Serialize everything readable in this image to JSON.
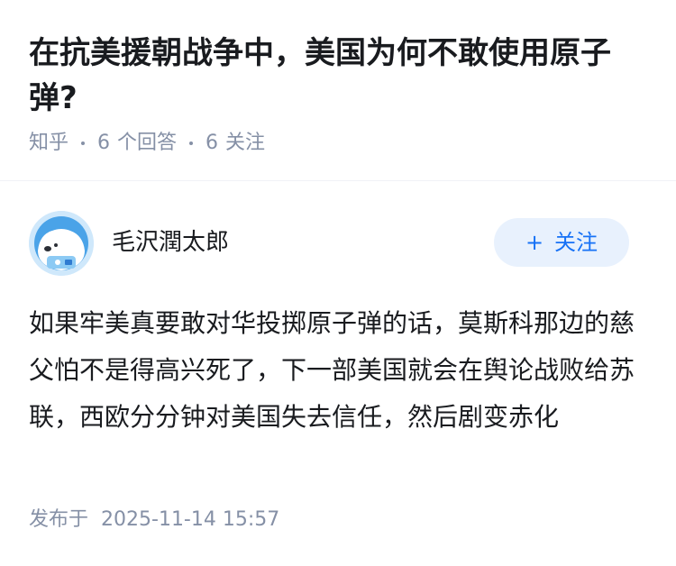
{
  "question": {
    "title": "在抗美援朝战争中，美国为何不敢使用原子弹?"
  },
  "meta": {
    "source": "知乎",
    "answers_count": "6",
    "answers_label": "个回答",
    "followers_count": "6",
    "followers_label": "关注"
  },
  "answer": {
    "author_name": "毛沢潤太郎",
    "follow_plus": "+",
    "follow_label": "关注",
    "content": "如果牢美真要敢对华投掷原子弹的话，莫斯科那边的慈父怕不是得高兴死了，下一部美国就会在舆论战败给苏联，西欧分分钟对美国失去信任，然后剧变赤化",
    "published_label": "发布于",
    "published_time": "2025-11-14 15:57"
  },
  "colors": {
    "accent": "#1772f6",
    "accent_bg": "#e8f1fd",
    "meta_gray": "#8590a6",
    "text": "#191b1f"
  },
  "icons": {
    "avatar": "avatar-icon"
  }
}
